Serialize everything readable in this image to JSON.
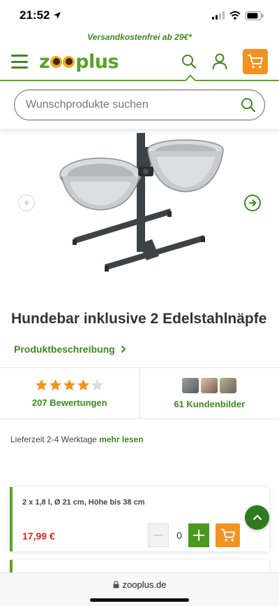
{
  "status_bar": {
    "time": "21:52"
  },
  "promo_banner": "Versandkostenfrei ab 29€*",
  "header": {
    "logo_text": "zooplus"
  },
  "search": {
    "placeholder": "Wunschprodukte suchen"
  },
  "product": {
    "title": "Hundebar inklusive 2 Edelstahlnäpfe",
    "description_link": "Produktbeschreibung"
  },
  "reviews": {
    "rating": 4,
    "max_rating": 5,
    "count_label": "207 Bewertungen",
    "customer_images_label": "61 Kundenbilder"
  },
  "delivery": {
    "text": "Lieferzeit 2-4 Werktage",
    "more_link": "mehr lesen"
  },
  "variant": {
    "name": "2 x 1,8 l, Ø 21 cm, Höhe bis 38 cm",
    "price": "17,99 €",
    "quantity": "0"
  },
  "browser": {
    "url": "zooplus.de"
  },
  "colors": {
    "brand_green": "#5da523",
    "link_green": "#3d8a1e",
    "cart_orange": "#f39221",
    "price_red": "#e1251b",
    "star_orange": "#f39221"
  },
  "icons": [
    "location-arrow-icon",
    "signal-icon",
    "wifi-icon",
    "battery-icon",
    "menu-icon",
    "search-icon",
    "user-icon",
    "cart-icon",
    "chevron-left-icon",
    "chevron-right-icon",
    "star-icon",
    "minus-icon",
    "plus-icon",
    "chevron-up-icon",
    "lock-icon"
  ]
}
